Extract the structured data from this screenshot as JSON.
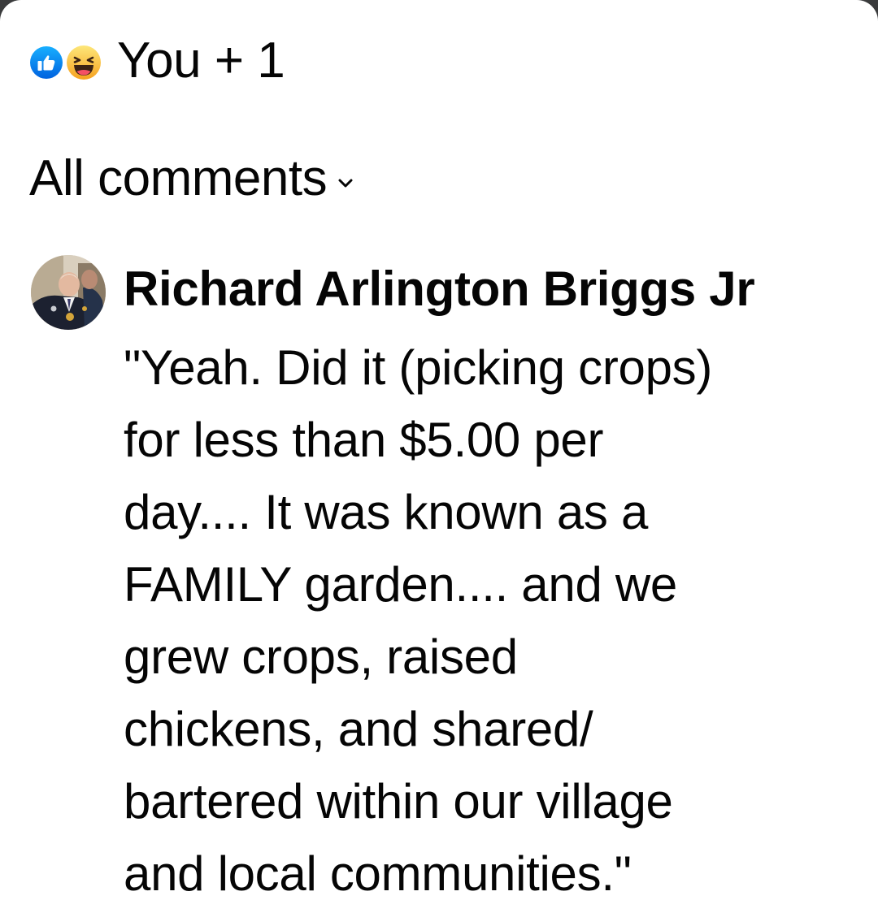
{
  "reactions": {
    "icons": [
      "like-icon",
      "haha-icon"
    ],
    "summary": "You + 1",
    "colors": {
      "like": "#1877f2",
      "haha": "#f7b125"
    }
  },
  "filter": {
    "label": "All comments",
    "icon": "chevron-down-icon"
  },
  "comment": {
    "author": "Richard Arlington Briggs Jr",
    "avatar_icon": "avatar",
    "text_lines": [
      "\"Yeah. Did it (picking crops)",
      "for less than $5.00 per",
      "day.... It was known as a",
      "FAMILY garden.... and we",
      "grew crops, raised",
      "chickens, and shared/",
      "bartered within our village",
      "and local communities.\""
    ]
  }
}
